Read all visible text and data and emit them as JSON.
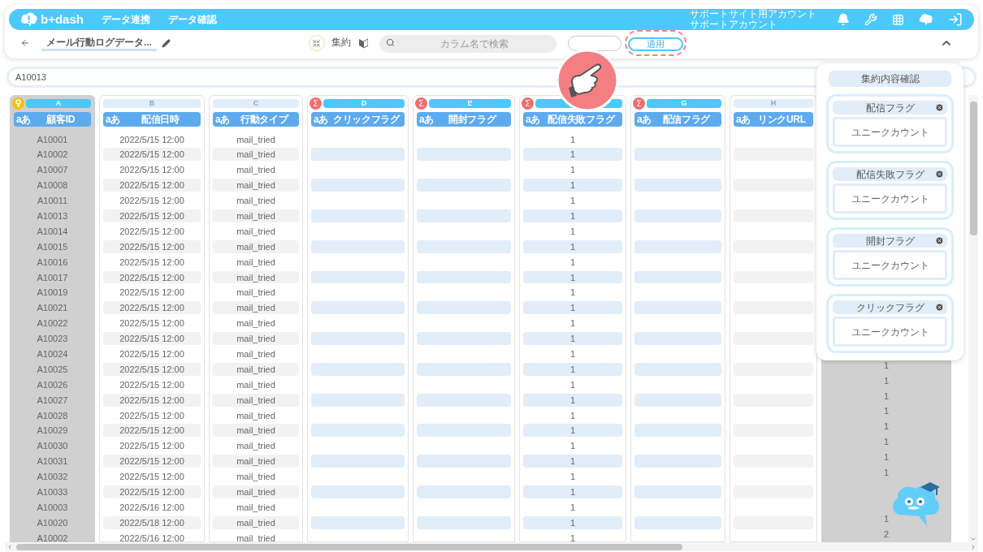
{
  "header": {
    "logo": "b+dash",
    "nav": [
      {
        "label": "データ連携"
      },
      {
        "label": "データ確認"
      }
    ],
    "account": [
      "サポートサイト用アカウント",
      "サポートアカウント"
    ]
  },
  "toolbar": {
    "title": "メール行動ログデータ...",
    "mode_label": "集約",
    "search": {
      "placeholder": "カラム名で検索"
    },
    "apply_button": "適用",
    "apply_highlighted": true
  },
  "filter": {
    "value": "A10013"
  },
  "table": {
    "columns": [
      {
        "letter": "A",
        "name": "顧客ID",
        "kind": "key",
        "type_badge": "aあ"
      },
      {
        "letter": "B",
        "name": "配信日時",
        "kind": "plain",
        "type_badge": "aあ"
      },
      {
        "letter": "C",
        "name": "行動タイプ",
        "kind": "plain",
        "type_badge": "aあ"
      },
      {
        "letter": "D",
        "name": "クリックフラグ",
        "kind": "sum",
        "symbol": "Σ",
        "type_badge": "aあ"
      },
      {
        "letter": "E",
        "name": "開封フラグ",
        "kind": "sum",
        "symbol": "Σ",
        "type_badge": "aあ"
      },
      {
        "name": "配信失敗フラグ",
        "kind": "sum",
        "symbol": "Σ",
        "type_badge": "aあ"
      },
      {
        "letter": "G",
        "name": "配信フラグ",
        "kind": "sum",
        "symbol": "Σ",
        "type_badge": "aあ"
      },
      {
        "letter": "H",
        "name": "リンクURL",
        "kind": "plain",
        "type_badge": "aあ"
      },
      {
        "kind": "key_hidden"
      }
    ],
    "rows": [
      {
        "cells": [
          "A10001",
          "2022/5/15 12:00",
          "mail_tried",
          null,
          null,
          "1",
          null,
          null,
          null
        ]
      },
      {
        "cells": [
          "A10002",
          "2022/5/15 12:00",
          "mail_tried",
          null,
          null,
          "1",
          null,
          null,
          null
        ]
      },
      {
        "cells": [
          "A10007",
          "2022/5/15 12:00",
          "mail_tried",
          null,
          null,
          "1",
          null,
          null,
          null
        ]
      },
      {
        "cells": [
          "A10008",
          "2022/5/15 12:00",
          "mail_tried",
          null,
          null,
          "1",
          null,
          null,
          null
        ]
      },
      {
        "cells": [
          "A10011",
          "2022/5/15 12:00",
          "mail_tried",
          null,
          null,
          "1",
          null,
          null,
          null
        ]
      },
      {
        "cells": [
          "A10013",
          "2022/5/15 12:00",
          "mail_tried",
          null,
          null,
          "1",
          null,
          null,
          null
        ]
      },
      {
        "cells": [
          "A10014",
          "2022/5/15 12:00",
          "mail_tried",
          null,
          null,
          "1",
          null,
          null,
          null
        ]
      },
      {
        "cells": [
          "A10015",
          "2022/5/15 12:00",
          "mail_tried",
          null,
          null,
          "1",
          null,
          null,
          null
        ]
      },
      {
        "cells": [
          "A10016",
          "2022/5/15 12:00",
          "mail_tried",
          null,
          null,
          "1",
          null,
          null,
          null
        ]
      },
      {
        "cells": [
          "A10017",
          "2022/5/15 12:00",
          "mail_tried",
          null,
          null,
          "1",
          null,
          null,
          null
        ]
      },
      {
        "cells": [
          "A10019",
          "2022/5/15 12:00",
          "mail_tried",
          null,
          null,
          "1",
          null,
          null,
          null
        ]
      },
      {
        "cells": [
          "A10021",
          "2022/5/15 12:00",
          "mail_tried",
          null,
          null,
          "1",
          null,
          null,
          null
        ]
      },
      {
        "cells": [
          "A10022",
          "2022/5/15 12:00",
          "mail_tried",
          null,
          null,
          "1",
          null,
          null,
          null
        ]
      },
      {
        "cells": [
          "A10023",
          "2022/5/15 12:00",
          "mail_tried",
          null,
          null,
          "1",
          null,
          null,
          null
        ]
      },
      {
        "cells": [
          "A10024",
          "2022/5/15 12:00",
          "mail_tried",
          null,
          null,
          "1",
          null,
          null,
          null
        ]
      },
      {
        "cells": [
          "A10025",
          "2022/5/15 12:00",
          "mail_tried",
          null,
          null,
          "1",
          null,
          null,
          "1"
        ]
      },
      {
        "cells": [
          "A10026",
          "2022/5/15 12:00",
          "mail_tried",
          null,
          null,
          "1",
          null,
          null,
          "1"
        ]
      },
      {
        "cells": [
          "A10027",
          "2022/5/15 12:00",
          "mail_tried",
          null,
          null,
          "1",
          null,
          null,
          "1"
        ]
      },
      {
        "cells": [
          "A10028",
          "2022/5/15 12:00",
          "mail_tried",
          null,
          null,
          "1",
          null,
          null,
          "1"
        ]
      },
      {
        "cells": [
          "A10029",
          "2022/5/15 12:00",
          "mail_tried",
          null,
          null,
          "1",
          null,
          null,
          "1"
        ]
      },
      {
        "cells": [
          "A10030",
          "2022/5/15 12:00",
          "mail_tried",
          null,
          null,
          "1",
          null,
          null,
          "1"
        ]
      },
      {
        "cells": [
          "A10031",
          "2022/5/15 12:00",
          "mail_tried",
          null,
          null,
          "1",
          null,
          null,
          "1"
        ]
      },
      {
        "cells": [
          "A10032",
          "2022/5/15 12:00",
          "mail_tried",
          null,
          null,
          "1",
          null,
          null,
          "1"
        ]
      },
      {
        "cells": [
          "A10033",
          "2022/5/15 12:00",
          "mail_tried",
          null,
          null,
          "1",
          null,
          null,
          null
        ]
      },
      {
        "cells": [
          "A10003",
          "2022/5/16 12:00",
          "mail_tried",
          null,
          null,
          "1",
          null,
          null,
          null
        ]
      },
      {
        "cells": [
          "A10020",
          "2022/5/18 12:00",
          "mail_tried",
          null,
          null,
          "1",
          null,
          null,
          "1"
        ]
      },
      {
        "cells": [
          "A10002",
          "2022/5/16 12:00",
          "mail_tried",
          null,
          null,
          "1",
          null,
          null,
          "2"
        ]
      }
    ]
  },
  "aggregation_panel": {
    "title": "集約内容確認",
    "items": [
      {
        "column": "配信フラグ",
        "method": "ユニークカウント"
      },
      {
        "column": "配信失敗フラグ",
        "method": "ユニークカウント"
      },
      {
        "column": "開封フラグ",
        "method": "ユニークカウント"
      },
      {
        "column": "クリックフラグ",
        "method": "ユニークカウント"
      }
    ]
  }
}
